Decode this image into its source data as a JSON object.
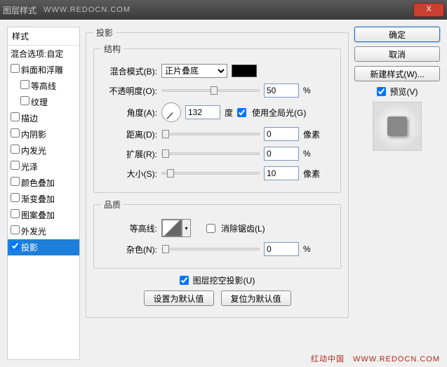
{
  "titlebar": {
    "title": "图层样式",
    "url": "WWW.REDOCN.COM",
    "close": "X"
  },
  "left": {
    "header": "样式",
    "blending": "混合选项:自定",
    "items": [
      {
        "label": "斜面和浮雕",
        "checked": false,
        "indent": 0
      },
      {
        "label": "等高线",
        "checked": false,
        "indent": 1
      },
      {
        "label": "纹理",
        "checked": false,
        "indent": 1
      },
      {
        "label": "描边",
        "checked": false,
        "indent": 0
      },
      {
        "label": "内阴影",
        "checked": false,
        "indent": 0
      },
      {
        "label": "内发光",
        "checked": false,
        "indent": 0
      },
      {
        "label": "光泽",
        "checked": false,
        "indent": 0
      },
      {
        "label": "颜色叠加",
        "checked": false,
        "indent": 0
      },
      {
        "label": "渐变叠加",
        "checked": false,
        "indent": 0
      },
      {
        "label": "图案叠加",
        "checked": false,
        "indent": 0
      },
      {
        "label": "外发光",
        "checked": false,
        "indent": 0
      },
      {
        "label": "投影",
        "checked": true,
        "indent": 0,
        "active": true
      }
    ]
  },
  "mid": {
    "title": "投影",
    "structure": {
      "legend": "结构",
      "blend_mode_label": "混合模式(B):",
      "blend_mode_value": "正片叠底",
      "opacity_label": "不透明度(O):",
      "opacity_value": "50",
      "pct": "%",
      "angle_label": "角度(A):",
      "angle_value": "132",
      "deg": "度",
      "global_light": "使用全局光(G)",
      "global_light_checked": true,
      "distance_label": "距离(D):",
      "distance_value": "0",
      "px": "像素",
      "spread_label": "扩展(R):",
      "spread_value": "0",
      "size_label": "大小(S):",
      "size_value": "10"
    },
    "quality": {
      "legend": "品质",
      "contour_label": "等高线:",
      "antialias": "消除锯齿(L)",
      "antialias_checked": false,
      "noise_label": "杂色(N):",
      "noise_value": "0"
    },
    "knockout": "图层挖空投影(U)",
    "knockout_checked": true,
    "set_default": "设置为默认值",
    "reset_default": "复位为默认值"
  },
  "right": {
    "ok": "确定",
    "cancel": "取消",
    "new_style": "新建样式(W)...",
    "preview_label": "预览(V)",
    "preview_checked": true
  },
  "footer_url": "红动中国　WWW.REDOCN.COM"
}
